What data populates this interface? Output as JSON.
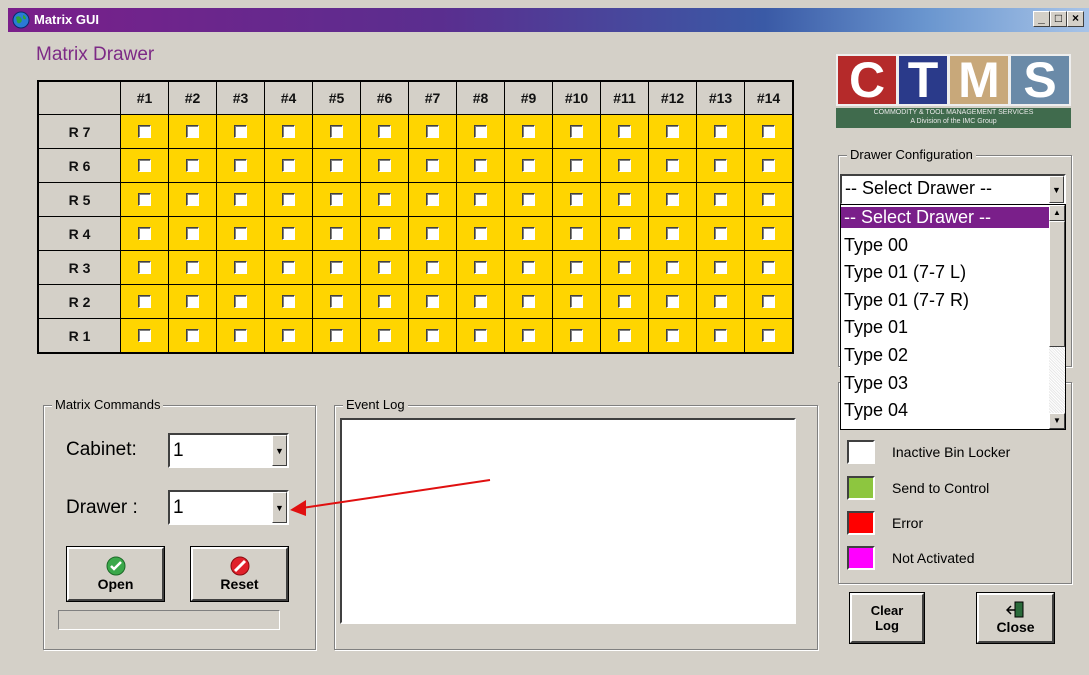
{
  "window": {
    "title": "Matrix GUI"
  },
  "heading": "Matrix Drawer",
  "grid": {
    "columns": [
      "#1",
      "#2",
      "#3",
      "#4",
      "#5",
      "#6",
      "#7",
      "#8",
      "#9",
      "#10",
      "#11",
      "#12",
      "#13",
      "#14"
    ],
    "rows": [
      "R 7",
      "R 6",
      "R 5",
      "R 4",
      "R 3",
      "R 2",
      "R 1"
    ],
    "cell_color": "#ffd500"
  },
  "logo": {
    "letters": [
      "C",
      "T",
      "M",
      "S"
    ],
    "tagline": "COMMODITY & TOOL MANAGEMENT SERVICES",
    "subline": "A Division of the IMC Group"
  },
  "drawer_config": {
    "label": "Drawer Configuration",
    "selected": "-- Select Drawer --",
    "options": [
      "-- Select Drawer --",
      "Type 00",
      "Type 01 (7-7 L)",
      "Type 01 (7-7 R)",
      "Type 01",
      "Type 02",
      "Type 03",
      "Type 04"
    ]
  },
  "legend": [
    {
      "label": "Inactive Bin Locker",
      "color": "#ffffff"
    },
    {
      "label": "Send to Control",
      "color": "#8dc63f"
    },
    {
      "label": "Error",
      "color": "#ff0000"
    },
    {
      "label": "Not Activated",
      "color": "#ff00ff"
    }
  ],
  "matrix_commands": {
    "label": "Matrix Commands",
    "cabinet_label": "Cabinet:",
    "cabinet_value": "1",
    "drawer_label": "Drawer :",
    "drawer_value": "1",
    "open_label": "Open",
    "reset_label": "Reset"
  },
  "event_log": {
    "label": "Event Log"
  },
  "buttons": {
    "clear_log": "Clear Log",
    "close": "Close"
  }
}
